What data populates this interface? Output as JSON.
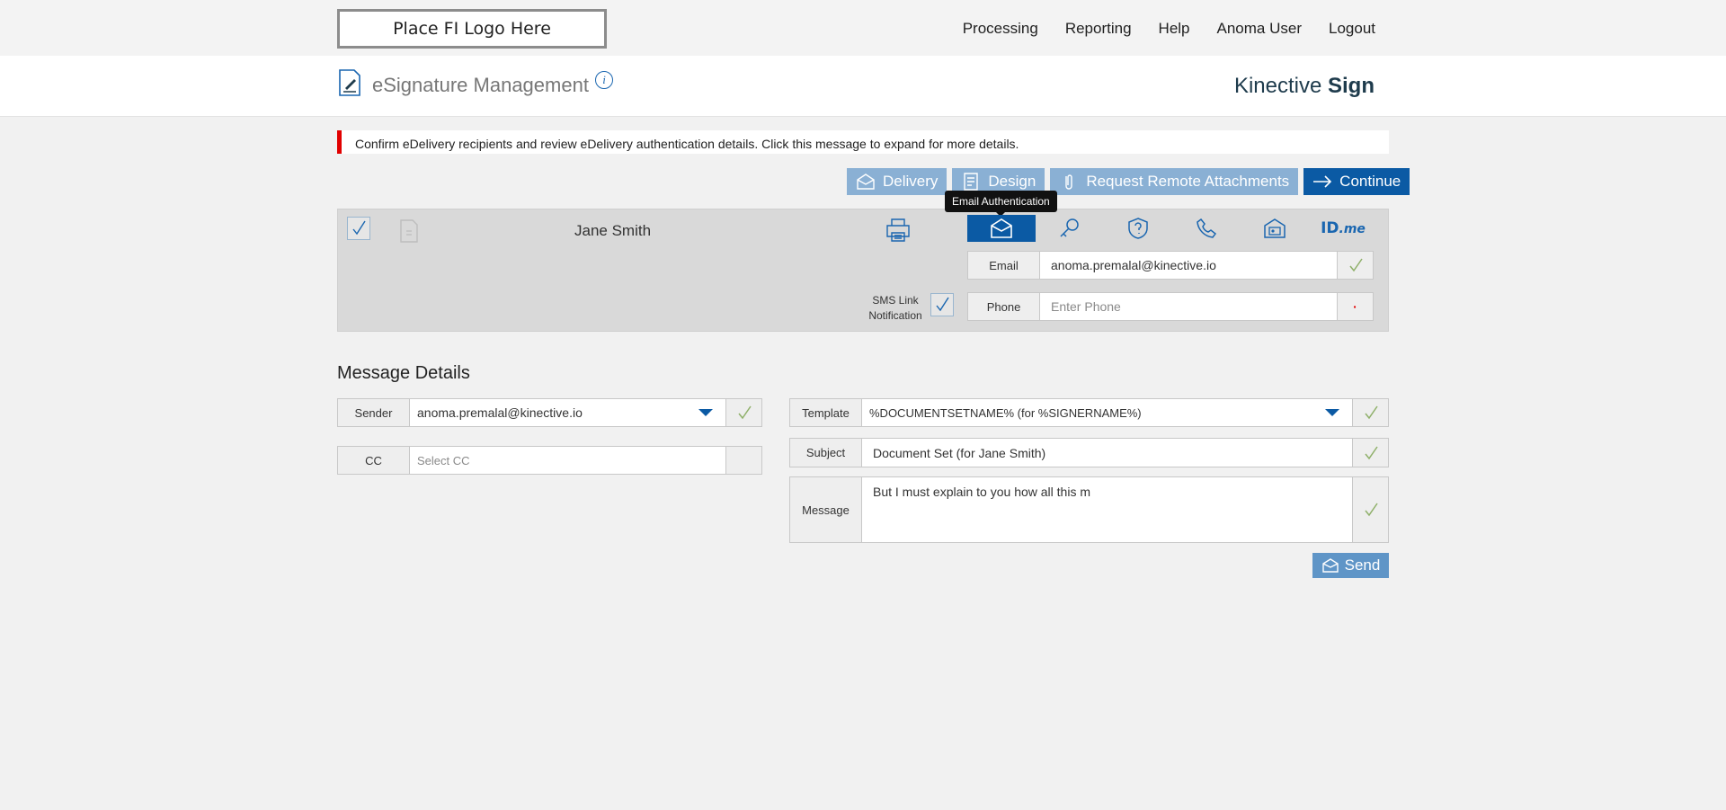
{
  "topbar": {
    "logo_text": "Place FI Logo Here",
    "nav": [
      "Processing",
      "Reporting",
      "Help",
      "Anoma User",
      "Logout"
    ]
  },
  "appbar": {
    "title": "eSignature Management",
    "info_glyph": "i",
    "brand_light": "Kinective",
    "brand_bold": "Sign"
  },
  "alert": {
    "message": "Confirm eDelivery recipients and review eDelivery authentication details. Click this message to expand for more details.",
    "accent_color": "#e10000"
  },
  "actions": {
    "delivery": "Delivery",
    "design": "Design",
    "remote_attachments": "Request Remote Attachments",
    "continue": "Continue"
  },
  "tooltip": "Email Authentication",
  "recipient": {
    "name": "Jane Smith",
    "auth_methods": [
      "email-auth-icon",
      "key-auth-icon",
      "question-auth-icon",
      "phone-auth-icon",
      "id-card-auth-icon",
      "idme-auth"
    ],
    "idme_text": "ID",
    "idme_suffix": ".me",
    "email_label": "Email",
    "email_value": "anoma.premalal@kinective.io",
    "phone_label": "Phone",
    "phone_placeholder": "Enter Phone",
    "phone_status": "·",
    "sms_label_1": "SMS Link",
    "sms_label_2": "Notification"
  },
  "message_details": {
    "title": "Message Details",
    "sender_label": "Sender",
    "sender_value": "anoma.premalal@kinective.io",
    "cc_label": "CC",
    "cc_placeholder": "Select CC",
    "template_label": "Template",
    "template_value": "%DOCUMENTSETNAME% (for %SIGNERNAME%)",
    "subject_label": "Subject",
    "subject_value": "Document Set (for Jane Smith)",
    "message_label": "Message",
    "message_value": "But I must explain to you how all this m",
    "send_label": "Send"
  },
  "colors": {
    "primary": "#0b5aa4",
    "light_button": "#8ab0d4",
    "check_green": "#8fb06a"
  }
}
